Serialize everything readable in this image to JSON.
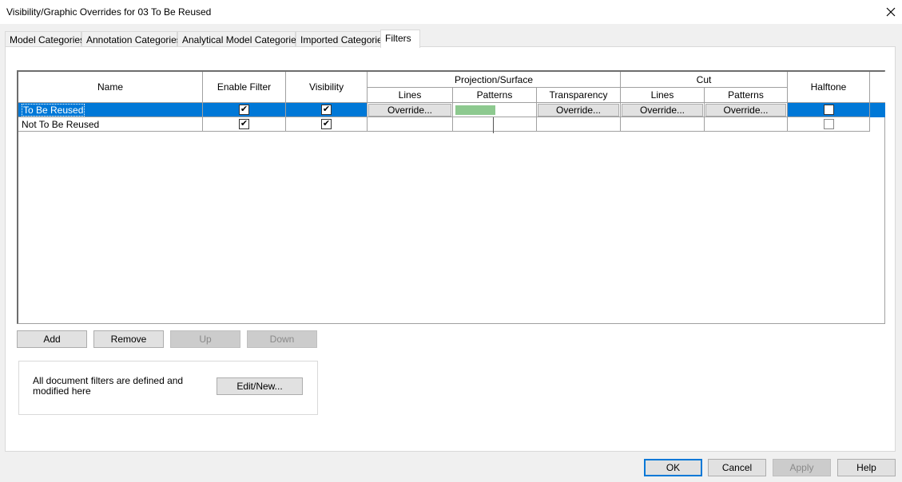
{
  "window": {
    "title": "Visibility/Graphic Overrides for 03 To Be Reused"
  },
  "tabs": [
    {
      "label": "Model Categories"
    },
    {
      "label": "Annotation Categories"
    },
    {
      "label": "Analytical Model Categories"
    },
    {
      "label": "Imported Categories"
    },
    {
      "label": "Filters",
      "active": true
    }
  ],
  "table": {
    "headers": {
      "name": "Name",
      "enable_filter": "Enable Filter",
      "visibility": "Visibility",
      "projection_surface": "Projection/Surface",
      "proj_lines": "Lines",
      "proj_patterns": "Patterns",
      "transparency": "Transparency",
      "cut": "Cut",
      "cut_lines": "Lines",
      "cut_patterns": "Patterns",
      "halftone": "Halftone"
    },
    "rows": [
      {
        "name": "To Be Reused",
        "enable_filter": true,
        "visibility": true,
        "proj_lines": "Override...",
        "proj_patterns_color": "#8dc98f",
        "transparency": "Override...",
        "cut_lines": "Override...",
        "cut_patterns": "Override...",
        "halftone": false,
        "selected": true
      },
      {
        "name": "Not To Be Reused",
        "enable_filter": true,
        "visibility": true,
        "halftone": false,
        "selected": false
      }
    ]
  },
  "row_buttons": {
    "add": "Add",
    "remove": "Remove",
    "up": "Up",
    "down": "Down"
  },
  "info": {
    "text": "All document filters are defined and modified here",
    "edit_new": "Edit/New..."
  },
  "footer": {
    "ok": "OK",
    "cancel": "Cancel",
    "apply": "Apply",
    "help": "Help"
  },
  "colors": {
    "selection": "#0078d7",
    "swatch": "#8dc98f"
  }
}
